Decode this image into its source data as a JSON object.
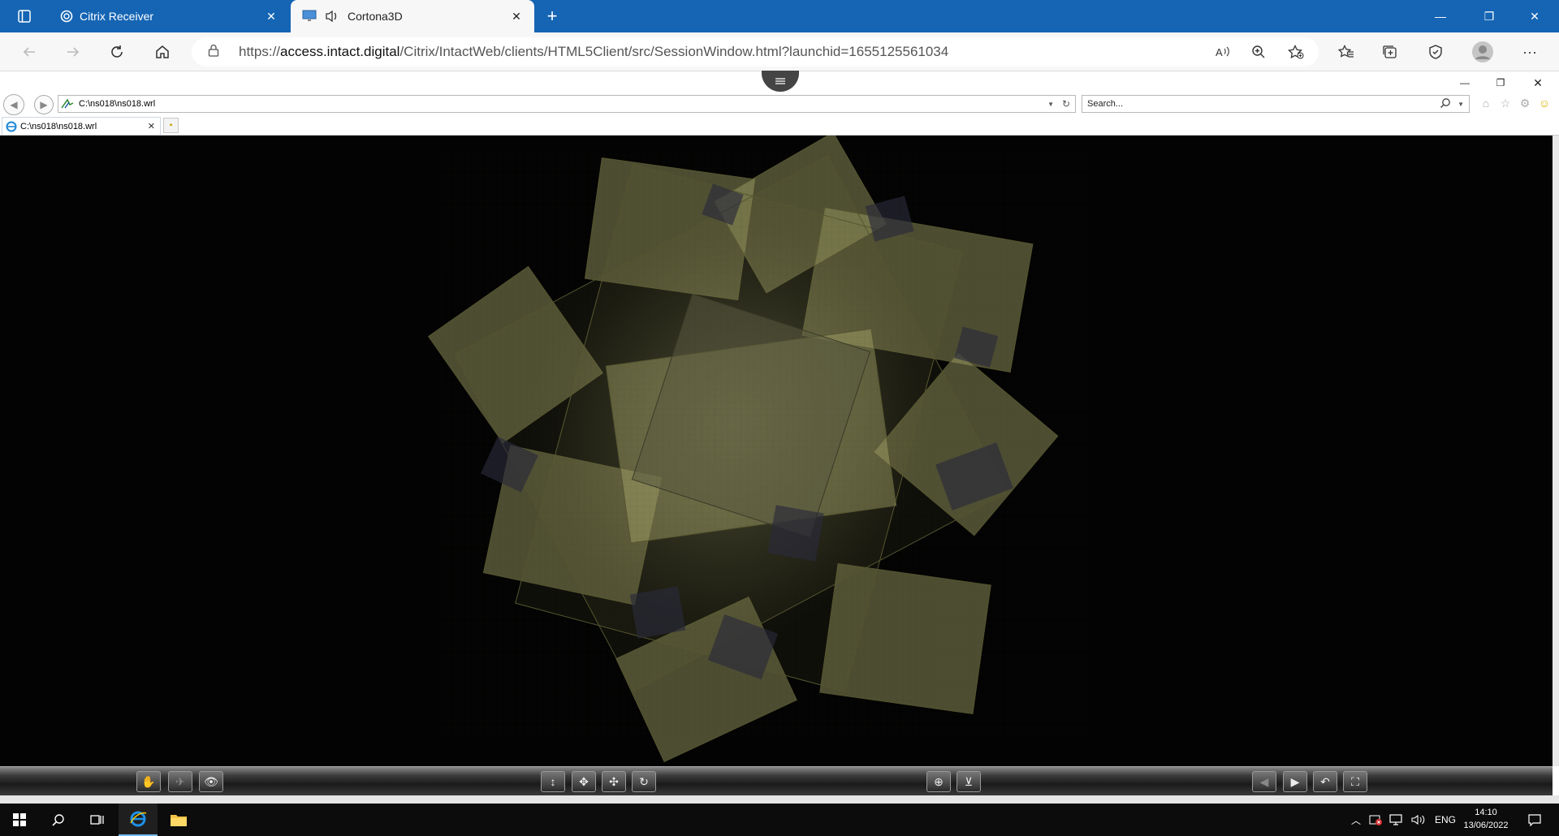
{
  "browser": {
    "tabs": [
      {
        "title": "Citrix Receiver",
        "active": false
      },
      {
        "title": "Cortona3D",
        "active": true
      }
    ],
    "url": {
      "scheme": "https://",
      "host": "access.intact.digital",
      "path": "/Citrix/IntactWeb/clients/HTML5Client/src/SessionWindow.html?launchid=1655125561034"
    },
    "accent_color": "#1565b4"
  },
  "ie": {
    "address": "C:\\ns018\\ns018.wrl",
    "search_placeholder": "Search...",
    "tab_title": "C:\\ns018\\ns018.wrl"
  },
  "taskbar": {
    "language": "ENG",
    "time": "14:10",
    "date": "13/06/2022"
  },
  "colors": {
    "viewport_bg": "#030303",
    "shape_fill": "#a8a86c"
  }
}
